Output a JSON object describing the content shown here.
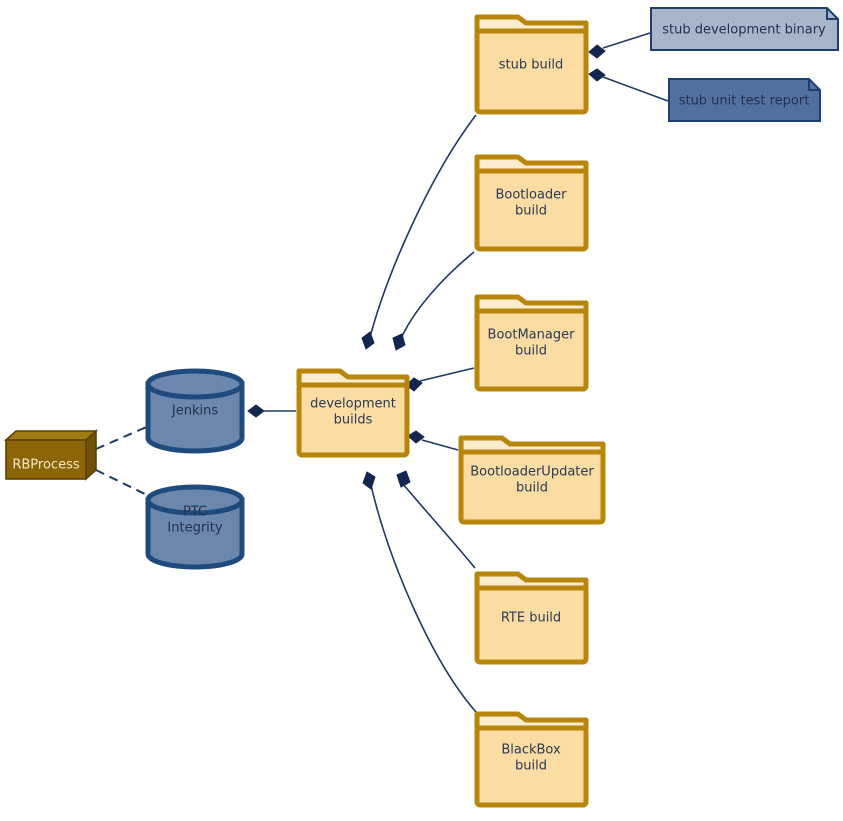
{
  "diagram": {
    "type": "uml-deployment-diagram",
    "colors": {
      "folder_fill": "#fbdca2",
      "folder_tab_fill": "#fcecce",
      "folder_stroke": "#b8860b",
      "db_fill": "#6c87ad",
      "db_stroke": "#1f4a7d",
      "note_light_fill": "#a8b6cb",
      "note_dark_fill": "#51709f",
      "note_stroke": "#1d3f6e",
      "node3d_fill": "#8b6508",
      "node3d_top_fill": "#a07a14",
      "node3d_stroke": "#5c4206",
      "node3d_text": "#f4e7c8",
      "link_stroke": "#1f3864",
      "diamond_fill": "#12264f",
      "background": "#ffffff"
    },
    "nodes": {
      "rbprocess": {
        "label": "RBProcess",
        "shape": "node-3d"
      },
      "jenkins": {
        "label": "Jenkins",
        "shape": "database"
      },
      "ptc_integrity": {
        "label_line1": "PTC",
        "label_line2": "Integrity",
        "shape": "database"
      },
      "development_builds": {
        "label_line1": "development",
        "label_line2": "builds",
        "shape": "folder"
      },
      "stub_build": {
        "label": "stub build",
        "shape": "folder"
      },
      "bootloader_build": {
        "label_line1": "Bootloader",
        "label_line2": "build",
        "shape": "folder"
      },
      "bootmanager_build": {
        "label_line1": "BootManager",
        "label_line2": "build",
        "shape": "folder"
      },
      "bootloaderupdater_build": {
        "label_line1": "BootloaderUpdater",
        "label_line2": "build",
        "shape": "folder"
      },
      "rte_build": {
        "label": "RTE build",
        "shape": "folder"
      },
      "blackbox_build": {
        "label_line1": "BlackBox",
        "label_line2": "build",
        "shape": "folder"
      },
      "stub_development_binary": {
        "label": "stub development binary",
        "shape": "note",
        "variant": "light"
      },
      "stub_unit_test_report": {
        "label": "stub unit test report",
        "shape": "note",
        "variant": "dark"
      }
    },
    "edges": [
      {
        "from": "rbprocess",
        "to": "jenkins",
        "style": "dashed"
      },
      {
        "from": "rbprocess",
        "to": "ptc_integrity",
        "style": "dashed"
      },
      {
        "from": "jenkins",
        "to": "development_builds",
        "style": "composition"
      },
      {
        "from": "development_builds",
        "to": "stub_build",
        "style": "composition"
      },
      {
        "from": "development_builds",
        "to": "bootloader_build",
        "style": "composition"
      },
      {
        "from": "development_builds",
        "to": "bootmanager_build",
        "style": "composition"
      },
      {
        "from": "development_builds",
        "to": "bootloaderupdater_build",
        "style": "composition"
      },
      {
        "from": "development_builds",
        "to": "rte_build",
        "style": "composition"
      },
      {
        "from": "development_builds",
        "to": "blackbox_build",
        "style": "composition"
      },
      {
        "from": "stub_build",
        "to": "stub_development_binary",
        "style": "composition"
      },
      {
        "from": "stub_build",
        "to": "stub_unit_test_report",
        "style": "composition"
      }
    ]
  }
}
